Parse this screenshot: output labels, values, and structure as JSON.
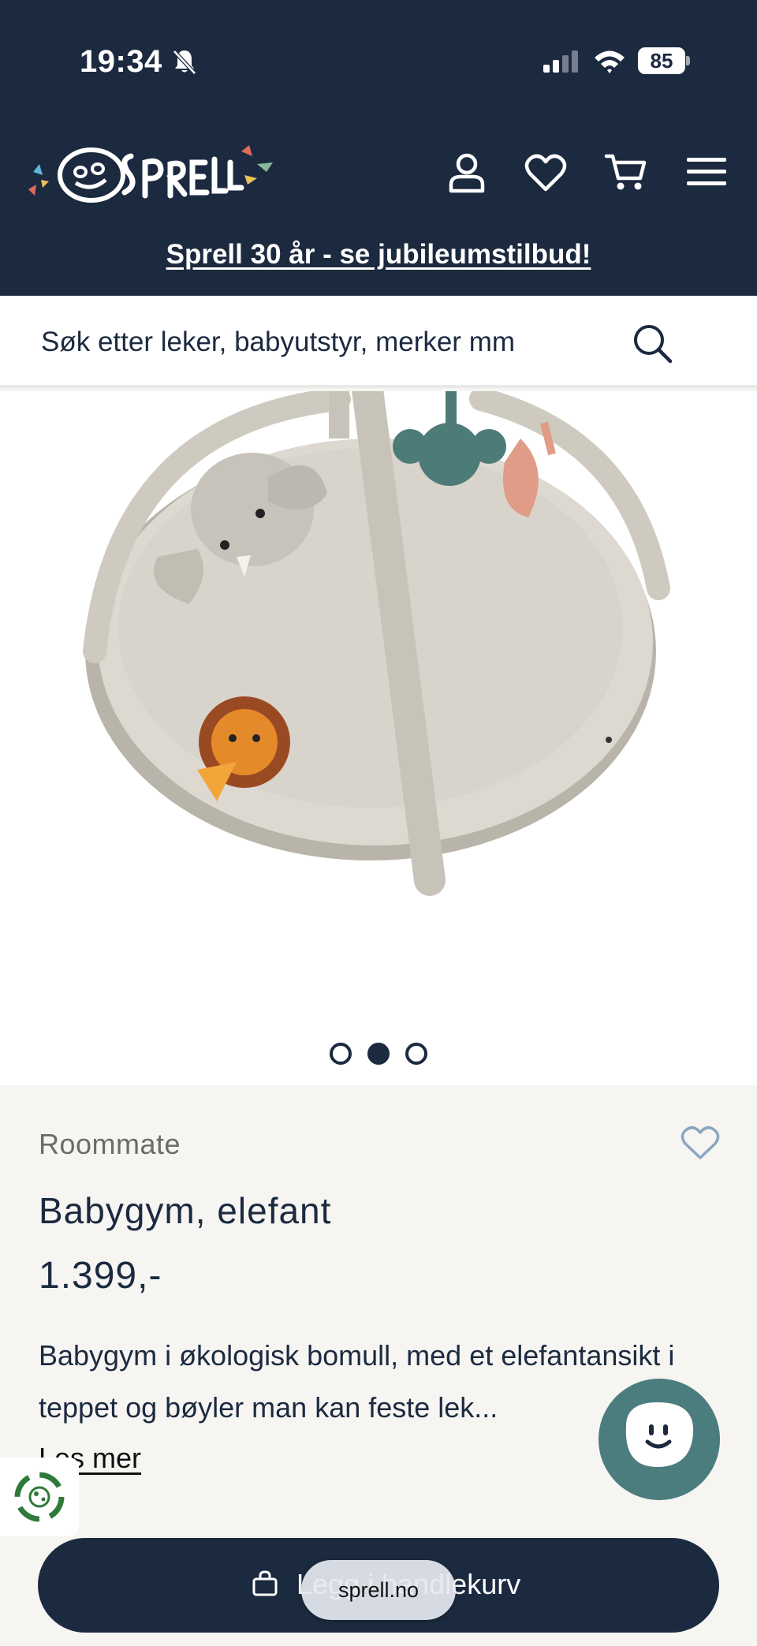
{
  "status_bar": {
    "time": "19:34",
    "battery": "85"
  },
  "header": {
    "logo_alt": "Sprell",
    "promo": "Sprell 30 år - se jubileumstilbud!"
  },
  "search": {
    "placeholder": "Søk etter leker, babyutstyr, merker mm"
  },
  "gallery": {
    "image_count": 3,
    "active_index": 1
  },
  "product": {
    "brand": "Roommate",
    "title": "Babygym, elefant",
    "price": "1.399,-",
    "description": "Babygym i økologisk bomull, med et elefantansikt i teppet og bøyler man kan feste lek...",
    "read_more": "Les mer"
  },
  "cart_button": {
    "label": "Legg i handlekurv"
  },
  "browser": {
    "url": "sprell.no"
  },
  "colors": {
    "navy": "#1c2a40",
    "teal": "#4c7d7e",
    "background": "#f6f5f2"
  }
}
